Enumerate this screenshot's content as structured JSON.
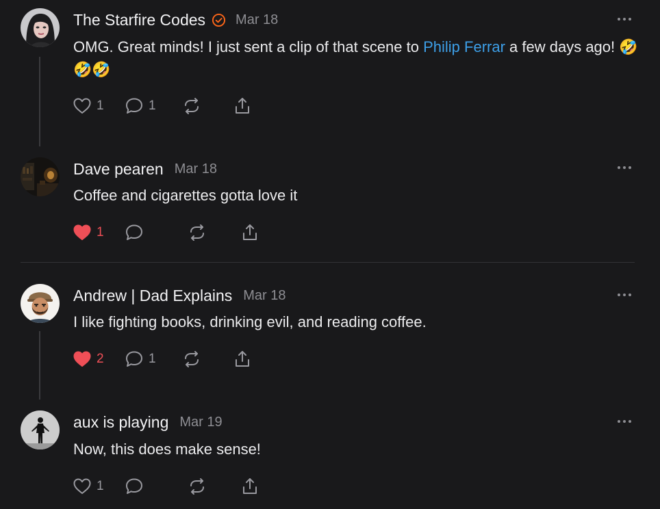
{
  "comments": [
    {
      "author": "The Starfire Codes",
      "verified": true,
      "date": "Mar 18",
      "text_before": "OMG. Great minds! I just sent a clip of that scene to ",
      "mention": "Philip Ferrar",
      "text_after": " a few days ago! 🤣🤣🤣",
      "likes": "1",
      "liked": false,
      "replies": "1",
      "avatar_icon": "woman-portrait-avatar"
    },
    {
      "author": "Dave pearen",
      "verified": false,
      "date": "Mar 18",
      "text": "Coffee and cigarettes gotta love it",
      "likes": "1",
      "liked": true,
      "replies": "",
      "avatar_icon": "dark-interior-avatar"
    },
    {
      "author": "Andrew | Dad Explains",
      "verified": false,
      "date": "Mar 18",
      "text": "I like fighting books, drinking evil, and reading coffee.",
      "likes": "2",
      "liked": true,
      "replies": "1",
      "avatar_icon": "bearded-man-cartoon-avatar"
    },
    {
      "author": "aux is playing",
      "verified": false,
      "date": "Mar 19",
      "text": "Now, this does make sense!",
      "likes": "1",
      "liked": false,
      "replies": "",
      "avatar_icon": "silhouette-figure-avatar"
    }
  ],
  "colors": {
    "background": "#19191b",
    "text": "#ececee",
    "muted": "#8e8e93",
    "mention": "#3d9fe8",
    "verified": "#ff6719",
    "like_active": "#ef4f57"
  }
}
